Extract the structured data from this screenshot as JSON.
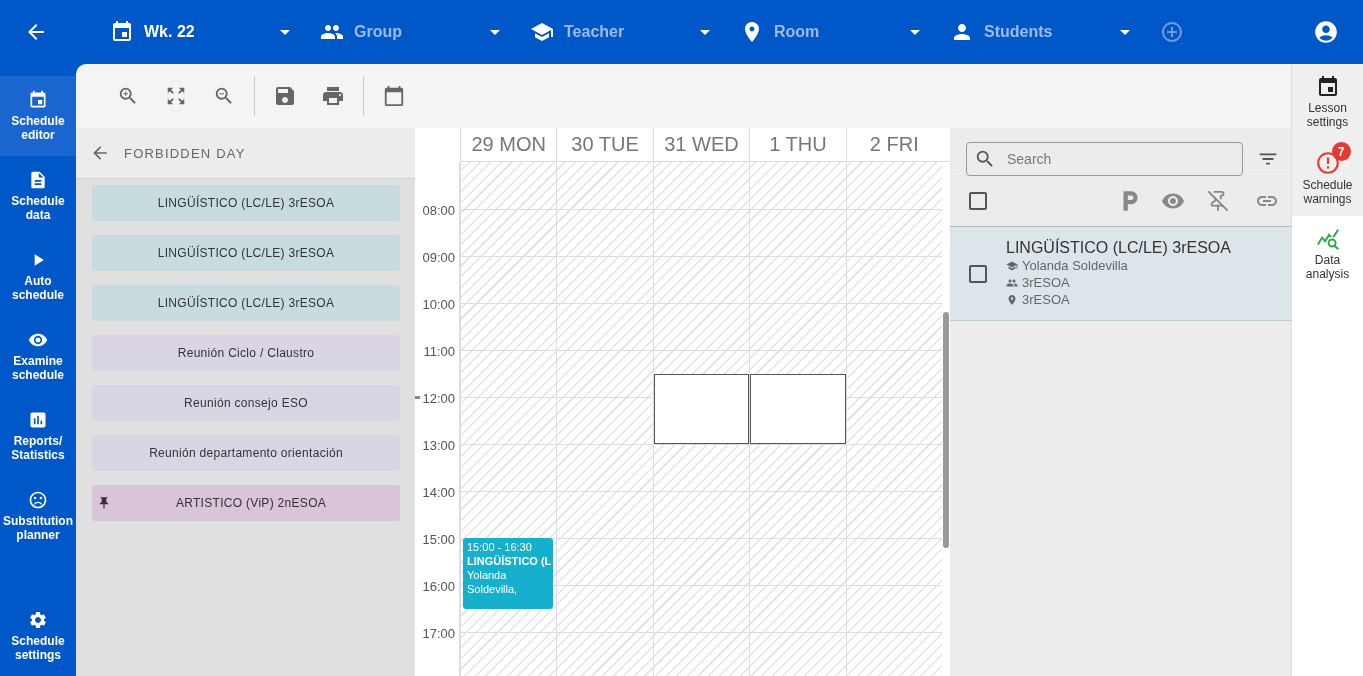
{
  "topbar": {
    "filters": [
      {
        "value": "Wk. 22"
      },
      {
        "placeholder": "Group"
      },
      {
        "placeholder": "Teacher"
      },
      {
        "placeholder": "Room"
      },
      {
        "placeholder": "Students"
      }
    ]
  },
  "nav": [
    {
      "label": "Schedule editor",
      "selected": true
    },
    {
      "label": "Schedule data",
      "selected": false
    },
    {
      "label": "Auto schedule",
      "selected": false
    },
    {
      "label": "Examine schedule",
      "selected": false
    },
    {
      "label": "Reports/ Statistics",
      "selected": false
    },
    {
      "label": "Substitution planner",
      "selected": false
    },
    {
      "label": "Schedule settings",
      "selected": false
    }
  ],
  "panel": {
    "title": "FORBIDDEN DAY",
    "lessons": [
      {
        "label": "LINGÜÍSTICO (LC/LE) 3rESOA",
        "color": "#c8dce0",
        "pinned": false
      },
      {
        "label": "LINGÜÍSTICO (LC/LE) 3rESOA",
        "color": "#c8dce0",
        "pinned": false
      },
      {
        "label": "LINGÜÍSTICO (LC/LE) 3rESOA",
        "color": "#c8dce0",
        "pinned": false
      },
      {
        "label": "Reunión Ciclo / Claustro",
        "color": "#dad5e5",
        "pinned": false
      },
      {
        "label": "Reunión consejo ESO",
        "color": "#dad5e5",
        "pinned": false
      },
      {
        "label": "Reunión departamento orientación",
        "color": "#dad5e5",
        "pinned": false
      },
      {
        "label": "ARTISTICO (ViP) 2nESOA",
        "color": "#d9c4da",
        "pinned": true
      }
    ]
  },
  "calendar": {
    "days": [
      "29 MON",
      "30 TUE",
      "31 WED",
      "1 THU",
      "2 FRI"
    ],
    "times": [
      "08:00",
      "09:00",
      "10:00",
      "11:00",
      "12:00",
      "13:00",
      "14:00",
      "15:00",
      "16:00",
      "17:00"
    ],
    "events": [
      {
        "kind": "lesson",
        "time": "15:00 - 16:30",
        "title": "LINGÜÍSTICO (L",
        "detail": "Yolanda Soldevilla,"
      },
      {
        "kind": "slot"
      },
      {
        "kind": "slot"
      }
    ]
  },
  "list": {
    "search": {
      "placeholder": "Search"
    },
    "select_all": {
      "checked": false
    },
    "items": [
      {
        "title": "LINGÜÍSTICO (LC/LE) 3rESOA",
        "teacher": "Yolanda Soldevilla",
        "group": "3rESOA",
        "room": "3rESOA",
        "checked": false
      }
    ]
  },
  "rail": [
    {
      "label": "Lesson settings",
      "selected": false
    },
    {
      "label": "Schedule warnings",
      "badge": "7",
      "selected": false
    },
    {
      "label": "Data analysis",
      "selected": true
    }
  ]
}
